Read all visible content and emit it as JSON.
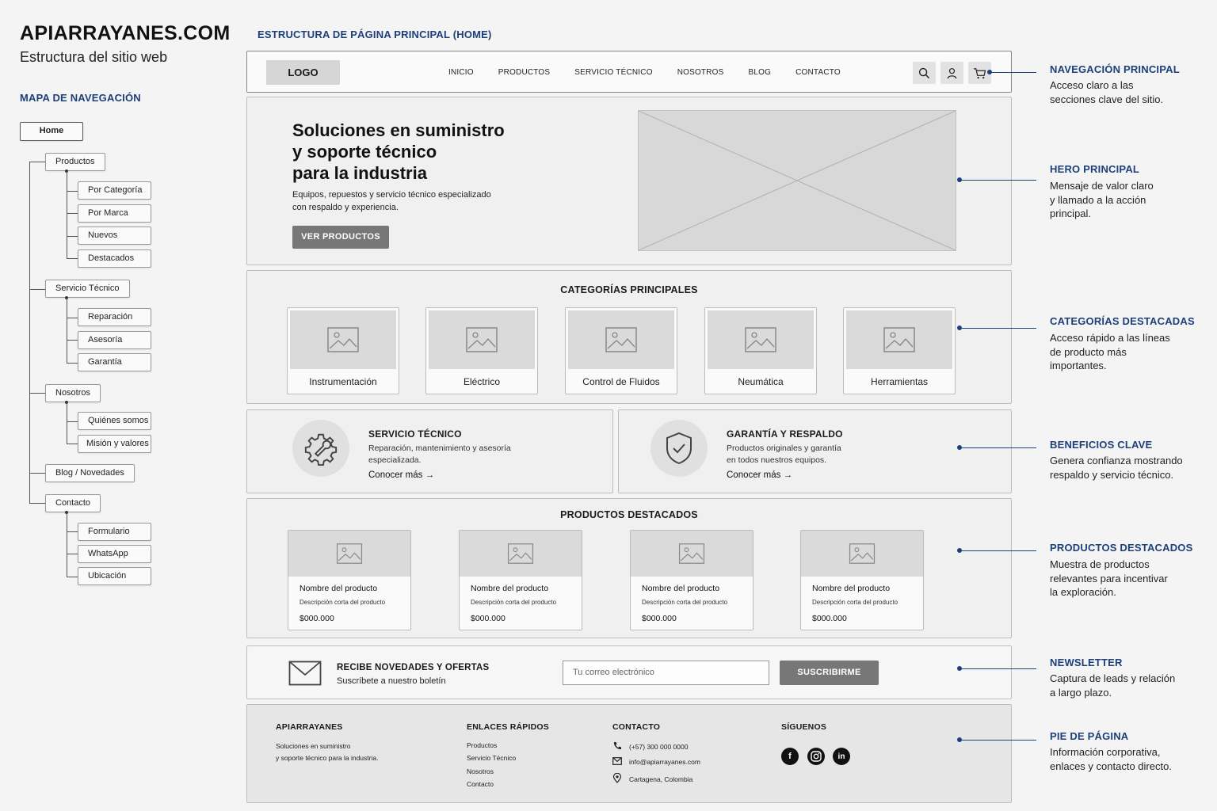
{
  "header": {
    "brand": "APIARRAYANES.COM",
    "subtitle": "Estructura del sitio web"
  },
  "sitemap": {
    "title": "MAPA DE NAVEGACIÓN",
    "home": "Home",
    "groups": [
      {
        "label": "Productos",
        "children": [
          "Por Categoría",
          "Por Marca",
          "Nuevos",
          "Destacados"
        ]
      },
      {
        "label": "Servicio Técnico",
        "children": [
          "Reparación",
          "Asesoría",
          "Garantía"
        ]
      },
      {
        "label": "Nosotros",
        "children": [
          "Quiénes somos",
          "Misión y valores"
        ]
      },
      {
        "label": "Blog / Novedades",
        "children": []
      },
      {
        "label": "Contacto",
        "children": [
          "Formulario",
          "WhatsApp",
          "Ubicación"
        ]
      }
    ]
  },
  "wireframe": {
    "title": "ESTRUCTURA DE PÁGINA PRINCIPAL (HOME)",
    "navbar": {
      "logo": "LOGO",
      "links": [
        "INICIO",
        "PRODUCTOS",
        "SERVICIO TÉCNICO",
        "NOSOTROS",
        "BLOG",
        "CONTACTO"
      ],
      "icons": [
        "search-icon",
        "user-icon",
        "cart-icon"
      ]
    },
    "hero": {
      "title_lines": [
        "Soluciones en suministro",
        "y soporte técnico",
        "para la industria"
      ],
      "text_lines": [
        "Equipos, repuestos y servicio técnico especializado",
        "con respaldo y experiencia."
      ],
      "button": "VER PRODUCTOS"
    },
    "categories": {
      "title": "CATEGORÍAS PRINCIPALES",
      "items": [
        "Instrumentación",
        "Eléctrico",
        "Control de Fluidos",
        "Neumática",
        "Herramientas"
      ]
    },
    "benefits": [
      {
        "title": "SERVICIO TÉCNICO",
        "text_lines": [
          "Reparación, mantenimiento y asesoría",
          "especializada."
        ],
        "link": "Conocer más",
        "icon": "gear-wrench-icon"
      },
      {
        "title": "GARANTÍA Y RESPALDO",
        "text_lines": [
          "Productos originales y garantía",
          "en todos nuestros equipos."
        ],
        "link": "Conocer más",
        "icon": "shield-check-icon"
      }
    ],
    "featured": {
      "title": "PRODUCTOS DESTACADOS",
      "products": [
        {
          "name": "Nombre del producto",
          "desc": "Descripción corta del producto",
          "price": "$000.000"
        },
        {
          "name": "Nombre del producto",
          "desc": "Descripción corta del producto",
          "price": "$000.000"
        },
        {
          "name": "Nombre del producto",
          "desc": "Descripción corta del producto",
          "price": "$000.000"
        },
        {
          "name": "Nombre del producto",
          "desc": "Descripción corta del producto",
          "price": "$000.000"
        }
      ]
    },
    "newsletter": {
      "title": "RECIBE NOVEDADES Y OFERTAS",
      "subtitle": "Suscríbete a nuestro boletín",
      "placeholder": "Tu correo electrónico",
      "button": "SUSCRIBIRME"
    },
    "footer": {
      "brand": "APIARRAYANES",
      "brand_text_lines": [
        "Soluciones en suministro",
        "y soporte técnico para la industria."
      ],
      "links_title": "ENLACES RÁPIDOS",
      "links": [
        "Productos",
        "Servicio Técnico",
        "Nosotros",
        "Contacto"
      ],
      "contact_title": "CONTACTO",
      "contact": {
        "phone": "(+57) 300 000 0000",
        "email": "info@apiarrayanes.com",
        "location": "Cartagena, Colombia"
      },
      "social_title": "SÍGUENOS",
      "social": [
        "facebook-icon",
        "instagram-icon",
        "linkedin-icon"
      ]
    }
  },
  "annotations": [
    {
      "title": "NAVEGACIÓN PRINCIPAL",
      "lines": [
        "Acceso claro a las",
        "secciones clave del sitio."
      ]
    },
    {
      "title": "HERO PRINCIPAL",
      "lines": [
        "Mensaje de valor claro",
        "y llamado a la acción",
        "principal."
      ]
    },
    {
      "title": "CATEGORÍAS DESTACADAS",
      "lines": [
        "Acceso rápido a las líneas",
        "de producto más",
        "importantes."
      ]
    },
    {
      "title": "BENEFICIOS CLAVE",
      "lines": [
        "Genera confianza mostrando",
        "respaldo y servicio técnico."
      ]
    },
    {
      "title": "PRODUCTOS DESTACADOS",
      "lines": [
        "Muestra de productos",
        "relevantes para incentivar",
        "la exploración."
      ]
    },
    {
      "title": "NEWSLETTER",
      "lines": [
        "Captura de leads y relación",
        "a largo plazo."
      ]
    },
    {
      "title": "PIE DE PÁGINA",
      "lines": [
        "Información corporativa,",
        "enlaces y contacto directo."
      ]
    }
  ],
  "colors": {
    "accent": "#1d3f7a",
    "button": "#777777",
    "placeholder": "#d8d8d8"
  }
}
